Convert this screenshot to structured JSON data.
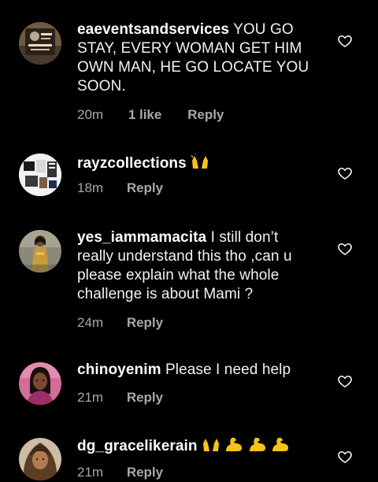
{
  "comments": [
    {
      "username": "eaeventsandservices",
      "text": "YOU GO STAY, EVERY WOMAN GET HIM OWN MAN, HE GO LOCATE YOU SOON.",
      "time": "20m",
      "likes": "1 like",
      "reply": "Reply"
    },
    {
      "username": "rayzcollections",
      "text": "",
      "emoji": "raising-hands",
      "time": "18m",
      "reply": "Reply"
    },
    {
      "username": "yes_iammamacita",
      "text": "I still don’t really understand this tho ,can u please explain what the whole challenge is about Mami ?",
      "time": "24m",
      "reply": "Reply"
    },
    {
      "username": "chinoyenim",
      "text": "Please I need help",
      "time": "21m",
      "reply": "Reply"
    },
    {
      "username": "dg_gracelikerain",
      "text": "",
      "emoji": "raising-hands, flexed-biceps x3",
      "time": "21m",
      "reply": "Reply"
    }
  ],
  "colors": {
    "background": "#000000",
    "text": "#f2f2f2",
    "meta": "#a8a8a8",
    "emoji": "#f7c21a"
  }
}
